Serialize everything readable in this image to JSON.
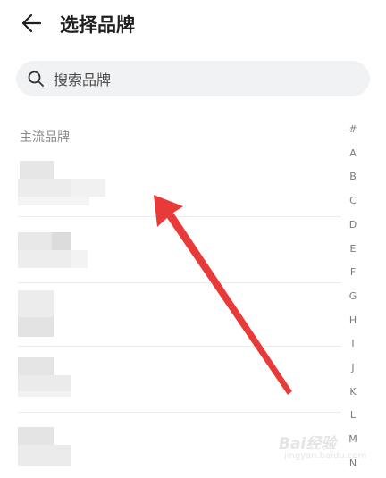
{
  "header": {
    "title": "选择品牌",
    "back_icon": "arrow-left-icon"
  },
  "search": {
    "placeholder": "搜索品牌",
    "value": "",
    "icon": "search-icon"
  },
  "section": {
    "title": "主流品牌"
  },
  "index_letters": [
    "#",
    "A",
    "B",
    "C",
    "D",
    "E",
    "F",
    "G",
    "H",
    "I",
    "J",
    "K",
    "L",
    "M",
    "N"
  ],
  "watermark": {
    "text": "Bai经验",
    "subtext": "jingyan.baidu.com"
  },
  "colors": {
    "arrow": "#e93a3a",
    "index_text": "#7a7a7a",
    "section_text": "#8a8a8a",
    "search_bg": "#f1f2f3"
  }
}
